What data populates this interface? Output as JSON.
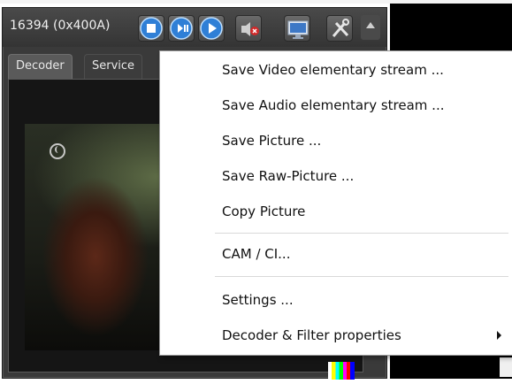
{
  "player": {
    "channel_label": "16394 (0x400A)",
    "tabs": [
      {
        "label": "Decoder"
      },
      {
        "label": "Service"
      }
    ],
    "toolbar_icons": [
      "stop-icon",
      "pause-icon",
      "play-icon",
      "mute-icon",
      "display-icon",
      "tools-icon"
    ]
  },
  "context_menu": {
    "items": [
      {
        "label": "Save Video elementary stream ..."
      },
      {
        "label": "Save Audio elementary stream ..."
      },
      {
        "label": "Save Picture ..."
      },
      {
        "label": "Save Raw-Picture ..."
      },
      {
        "label": "Copy Picture"
      },
      {
        "label": "CAM / CI..."
      },
      {
        "label": "Settings ..."
      },
      {
        "label": "Decoder & Filter properties"
      }
    ]
  },
  "colors": {
    "accent_blue": "#2f7fd6",
    "mute_red": "#d12a2a",
    "panel_dark": "#3a3a3a"
  }
}
